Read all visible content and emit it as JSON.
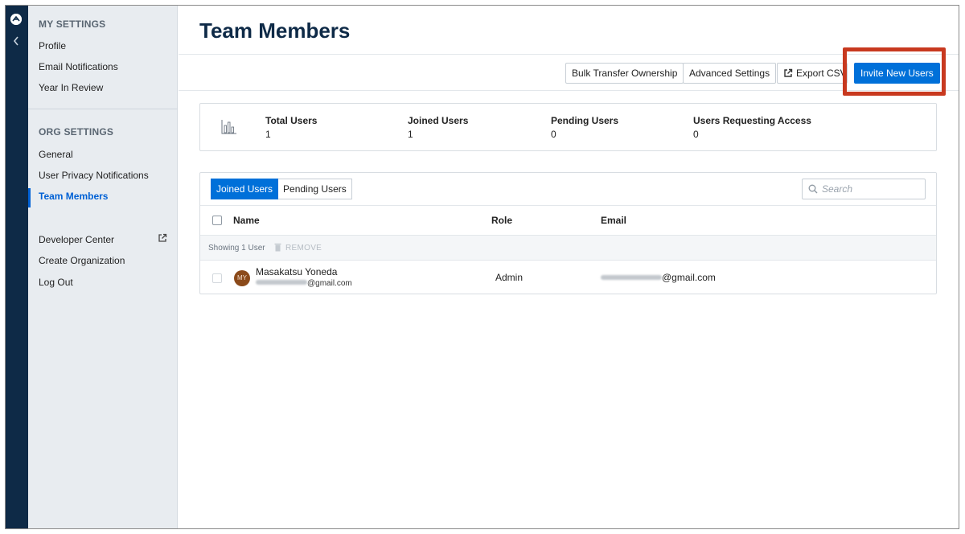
{
  "sidebar": {
    "my_settings_heading": "MY SETTINGS",
    "my_settings": [
      {
        "label": "Profile"
      },
      {
        "label": "Email Notifications"
      },
      {
        "label": "Year In Review"
      }
    ],
    "org_settings_heading": "ORG SETTINGS",
    "org_settings": [
      {
        "label": "General"
      },
      {
        "label": "User Privacy Notifications"
      },
      {
        "label": "Team Members",
        "active": true
      }
    ],
    "footer": [
      {
        "label": "Developer Center",
        "icon": "external-link-icon"
      },
      {
        "label": "Create Organization"
      },
      {
        "label": "Log Out"
      }
    ]
  },
  "page": {
    "title": "Team Members"
  },
  "toolbar": {
    "bulk_transfer": "Bulk Transfer Ownership",
    "advanced_settings": "Advanced Settings",
    "export_csv": "Export CSV",
    "invite_new_users": "Invite New Users"
  },
  "stats": [
    {
      "label": "Total Users",
      "value": "1"
    },
    {
      "label": "Joined Users",
      "value": "1"
    },
    {
      "label": "Pending Users",
      "value": "0"
    },
    {
      "label": "Users Requesting Access",
      "value": "0"
    }
  ],
  "tabs": [
    {
      "label": "Joined Users",
      "active": true
    },
    {
      "label": "Pending Users",
      "active": false
    }
  ],
  "search": {
    "placeholder": "Search"
  },
  "table": {
    "columns": [
      "Name",
      "Role",
      "Email"
    ],
    "showing": "Showing 1 User",
    "remove_label": "REMOVE",
    "rows": [
      {
        "initials": "MY",
        "name": "Masakatsu Yoneda",
        "email_suffix": "@gmail.com",
        "role": "Admin",
        "email_display_suffix": "@gmail.com"
      }
    ]
  },
  "colors": {
    "rail": "#0e2a47",
    "sidebar": "#e8ecf0",
    "accent": "#0070d9",
    "highlight": "#c8391f",
    "avatar": "#8b4a1a"
  }
}
